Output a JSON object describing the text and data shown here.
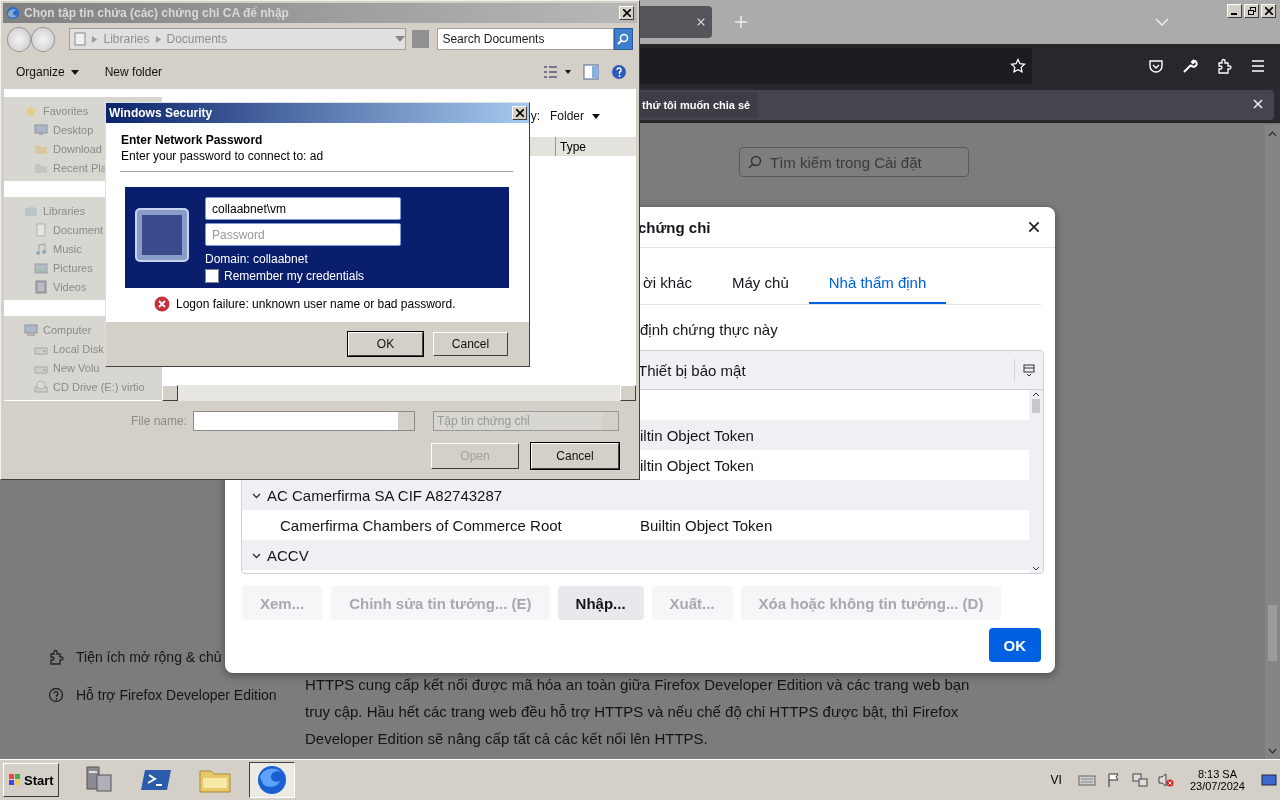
{
  "browser": {
    "notification": {
      "text": "thứ tôi muốn chia sẻ"
    },
    "search": {
      "placeholder": "Tìm kiếm trong Cài đặt"
    },
    "sidebar": {
      "items": [
        {
          "label": "Tiện ích mở rộng & chủ",
          "kind": "extensions"
        },
        {
          "label": "Hỗ trợ Firefox Developer Edition",
          "kind": "help"
        }
      ]
    },
    "paragraph": "HTTPS cung cấp kết nối được mã hóa an toàn giữa Firefox Developer Edition và các trang web bạn truy cập. Hầu hết các trang web đều hỗ trợ HTTPS và nếu chế độ chỉ HTTPS được bật, thì Firefox Developer Edition sẽ nâng cấp tất cả các kết nối lên HTTPS."
  },
  "cert_dialog": {
    "title": "chứng chỉ",
    "tabs": [
      {
        "label": "ời khác",
        "selected": false
      },
      {
        "label": "Máy chủ",
        "selected": false
      },
      {
        "label": "Nhà thẩm định",
        "selected": true
      }
    ],
    "description": "định chứng thực này",
    "table": {
      "columns": [
        {
          "label": "Thiết bị bảo mật"
        }
      ],
      "groups": [
        {
          "children": [
            {
              "device": "iltin Object Token"
            },
            {
              "device": "iltin Object Token"
            }
          ]
        },
        {
          "name": "AC Camerfirma SA CIF A82743287",
          "expanded": true,
          "children": [
            {
              "name": "Camerfirma Chambers of Commerce Root",
              "device": "Builtin Object Token"
            }
          ]
        },
        {
          "name": "ACCV",
          "expanded": true
        }
      ]
    },
    "buttons": [
      {
        "label": "Xem...",
        "disabled": true
      },
      {
        "label": "Chỉnh sửa tin tưởng... (E)",
        "disabled": true
      },
      {
        "label": "Nhập...",
        "disabled": false
      },
      {
        "label": "Xuất...",
        "disabled": true
      },
      {
        "label": "Xóa hoặc không tin tưởng... (D)",
        "disabled": true
      }
    ],
    "ok": "OK"
  },
  "file_dialog": {
    "title": "Chọn tập tin chứa (các) chứng chỉ CA để nhập",
    "breadcrumb": [
      "Libraries",
      "Documents"
    ],
    "search": {
      "placeholder": "Search Documents"
    },
    "toolbar": [
      "Organize",
      "New folder"
    ],
    "nav": [
      {
        "label": "Favorites",
        "kind": "favorites",
        "children": [
          {
            "label": "Desktop",
            "kind": "desktop"
          },
          {
            "label": "Download",
            "kind": "folder"
          },
          {
            "label": "Recent Pla",
            "kind": "recent"
          }
        ]
      },
      {
        "label": "Libraries",
        "kind": "libraries",
        "children": [
          {
            "label": "Document",
            "kind": "document"
          },
          {
            "label": "Music",
            "kind": "music"
          },
          {
            "label": "Pictures",
            "kind": "pictures"
          },
          {
            "label": "Videos",
            "kind": "videos"
          }
        ]
      },
      {
        "label": "Computer",
        "kind": "computer",
        "children": [
          {
            "label": "Local Disk",
            "kind": "disk"
          },
          {
            "label": "New Volu",
            "kind": "disk"
          },
          {
            "label": "CD Drive (E:) virtio",
            "kind": "cdrom"
          }
        ]
      }
    ],
    "arrange": {
      "label": "y:",
      "value": "Folder"
    },
    "columns": [
      "Type"
    ],
    "file_name": {
      "label": "File name:"
    },
    "file_type": "Tập tin chứng chỉ",
    "buttons": [
      {
        "label": "Open",
        "disabled": true
      },
      {
        "label": "Cancel",
        "disabled": false
      }
    ]
  },
  "security_dialog": {
    "title": "Windows Security",
    "heading": "Enter Network Password",
    "subtitle": "Enter your password to connect to: ad",
    "username": "collaabnet\\vm",
    "password": {
      "placeholder": "Password"
    },
    "domain": "Domain: collaabnet",
    "remember": {
      "label": "Remember my credentials",
      "checked": false
    },
    "error": "Logon failure: unknown user name or bad password.",
    "buttons": [
      {
        "label": "OK",
        "default": true
      },
      {
        "label": "Cancel",
        "default": false
      }
    ]
  },
  "taskbar": {
    "start": "Start",
    "apps": [
      {
        "kind": "server-manager",
        "selected": false
      },
      {
        "kind": "powershell",
        "selected": false
      },
      {
        "kind": "explorer",
        "selected": false
      },
      {
        "kind": "firefox",
        "selected": true
      }
    ],
    "language": "VI",
    "time": "8:13 SA",
    "date": "23/07/2024"
  }
}
